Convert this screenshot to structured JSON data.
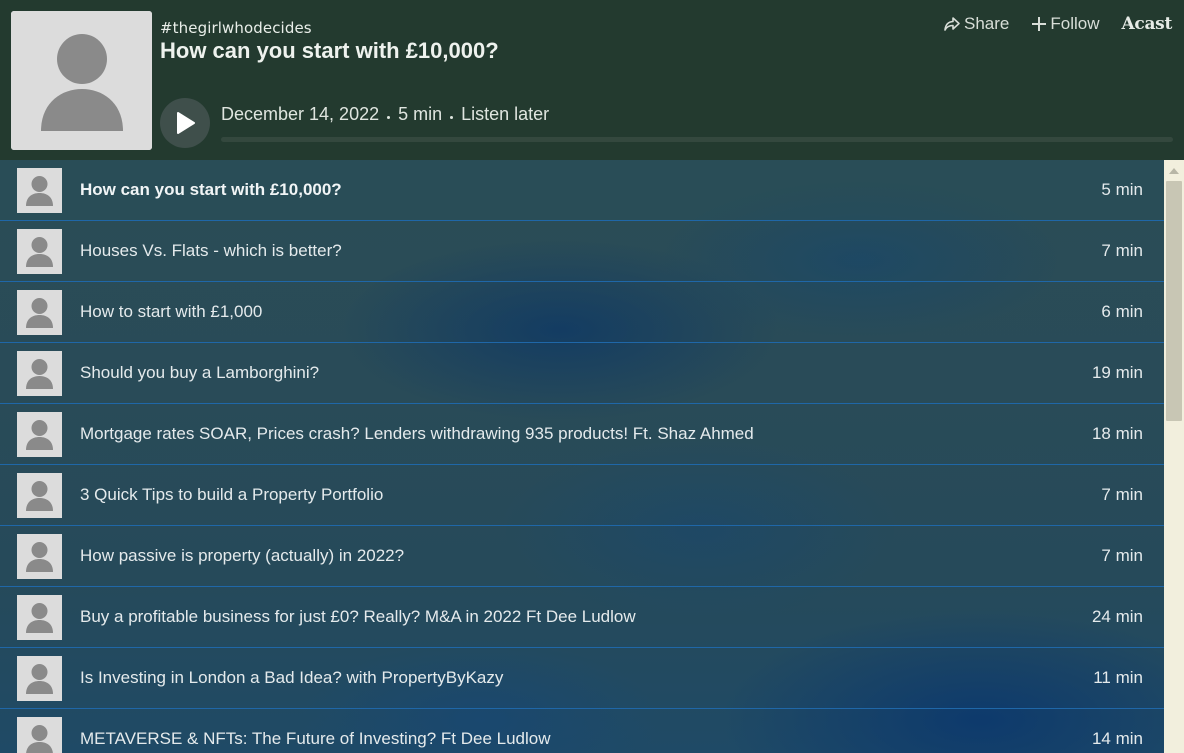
{
  "header": {
    "show_name": "#thegirlwhodecides",
    "episode_title": "How can you start with £10,000?",
    "share_label": "Share",
    "follow_label": "Follow",
    "brand": "Acast",
    "date": "December 14, 2022",
    "duration": "5 min",
    "listen_later": "Listen later",
    "progress_fraction": 0.0
  },
  "episodes": [
    {
      "title": "How can you start with £10,000?",
      "duration": "5 min",
      "current": true
    },
    {
      "title": "Houses Vs. Flats - which is better?",
      "duration": "7 min"
    },
    {
      "title": "How to start with £1,000",
      "duration": "6 min"
    },
    {
      "title": "Should you buy a Lamborghini?",
      "duration": "19 min"
    },
    {
      "title": "Mortgage rates SOAR, Prices crash? Lenders withdrawing 935 products! Ft. Shaz Ahmed",
      "duration": "18 min"
    },
    {
      "title": "3 Quick Tips to build a Property Portfolio",
      "duration": "7 min"
    },
    {
      "title": "How passive is property (actually) in 2022?",
      "duration": "7 min"
    },
    {
      "title": "Buy a profitable business for just £0? Really? M&A in 2022 Ft Dee Ludlow",
      "duration": "24 min"
    },
    {
      "title": "Is Investing in London a Bad Idea? with PropertyByKazy",
      "duration": "11 min"
    },
    {
      "title": "METAVERSE & NFTs: The Future of Investing? Ft Dee Ludlow",
      "duration": "14 min"
    }
  ],
  "icons": {
    "share": "share-arrow-icon",
    "follow": "plus-icon",
    "play": "play-icon",
    "cover": "person-placeholder-icon",
    "scroll_up": "scroll-up-arrow-icon"
  },
  "colors": {
    "header_bg": "#233a2f",
    "list_border": "#1f67a8",
    "text": "#e4eaec"
  }
}
